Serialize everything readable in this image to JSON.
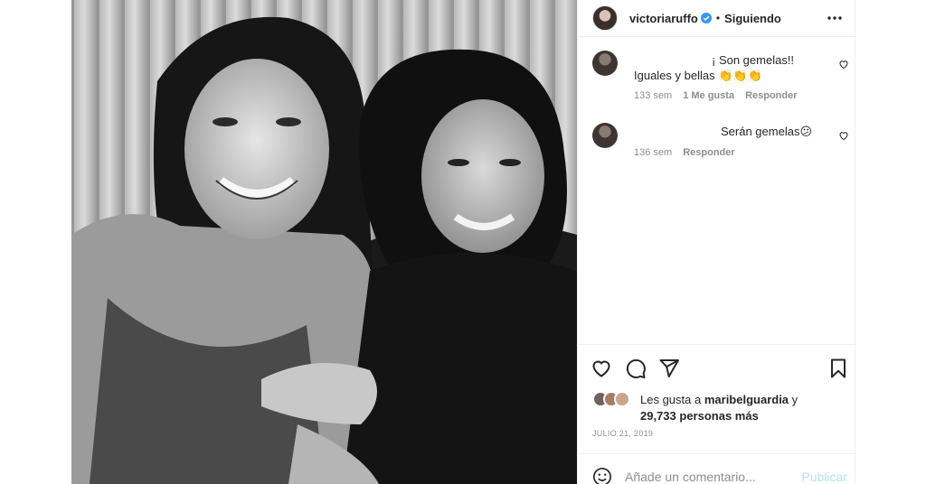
{
  "post": {
    "username": "victoriaruffo",
    "separator": "•",
    "follow_status": "Siguiendo",
    "photo_description": "black and white photo of two women smiling"
  },
  "comments": [
    {
      "text_line1": "¡ Son gemelas!!",
      "text_line2": "Iguales y bellas 👏👏👏",
      "time": "133 sem",
      "likes": "1 Me gusta",
      "reply": "Responder"
    },
    {
      "text_line1": "Serán gemelas😕",
      "time": "136 sem",
      "reply": "Responder"
    }
  ],
  "likes": {
    "prefix": "Les gusta a",
    "user": "maribelguardia",
    "conj": "y",
    "count": "29,733 personas más"
  },
  "date": "JULIO 21, 2019",
  "composer": {
    "placeholder": "Añade un comentario...",
    "publish_label": "Publicar"
  },
  "colors": {
    "verified": "#3897f0",
    "publish": "#b2dffc",
    "muted": "#8e8e8e"
  }
}
